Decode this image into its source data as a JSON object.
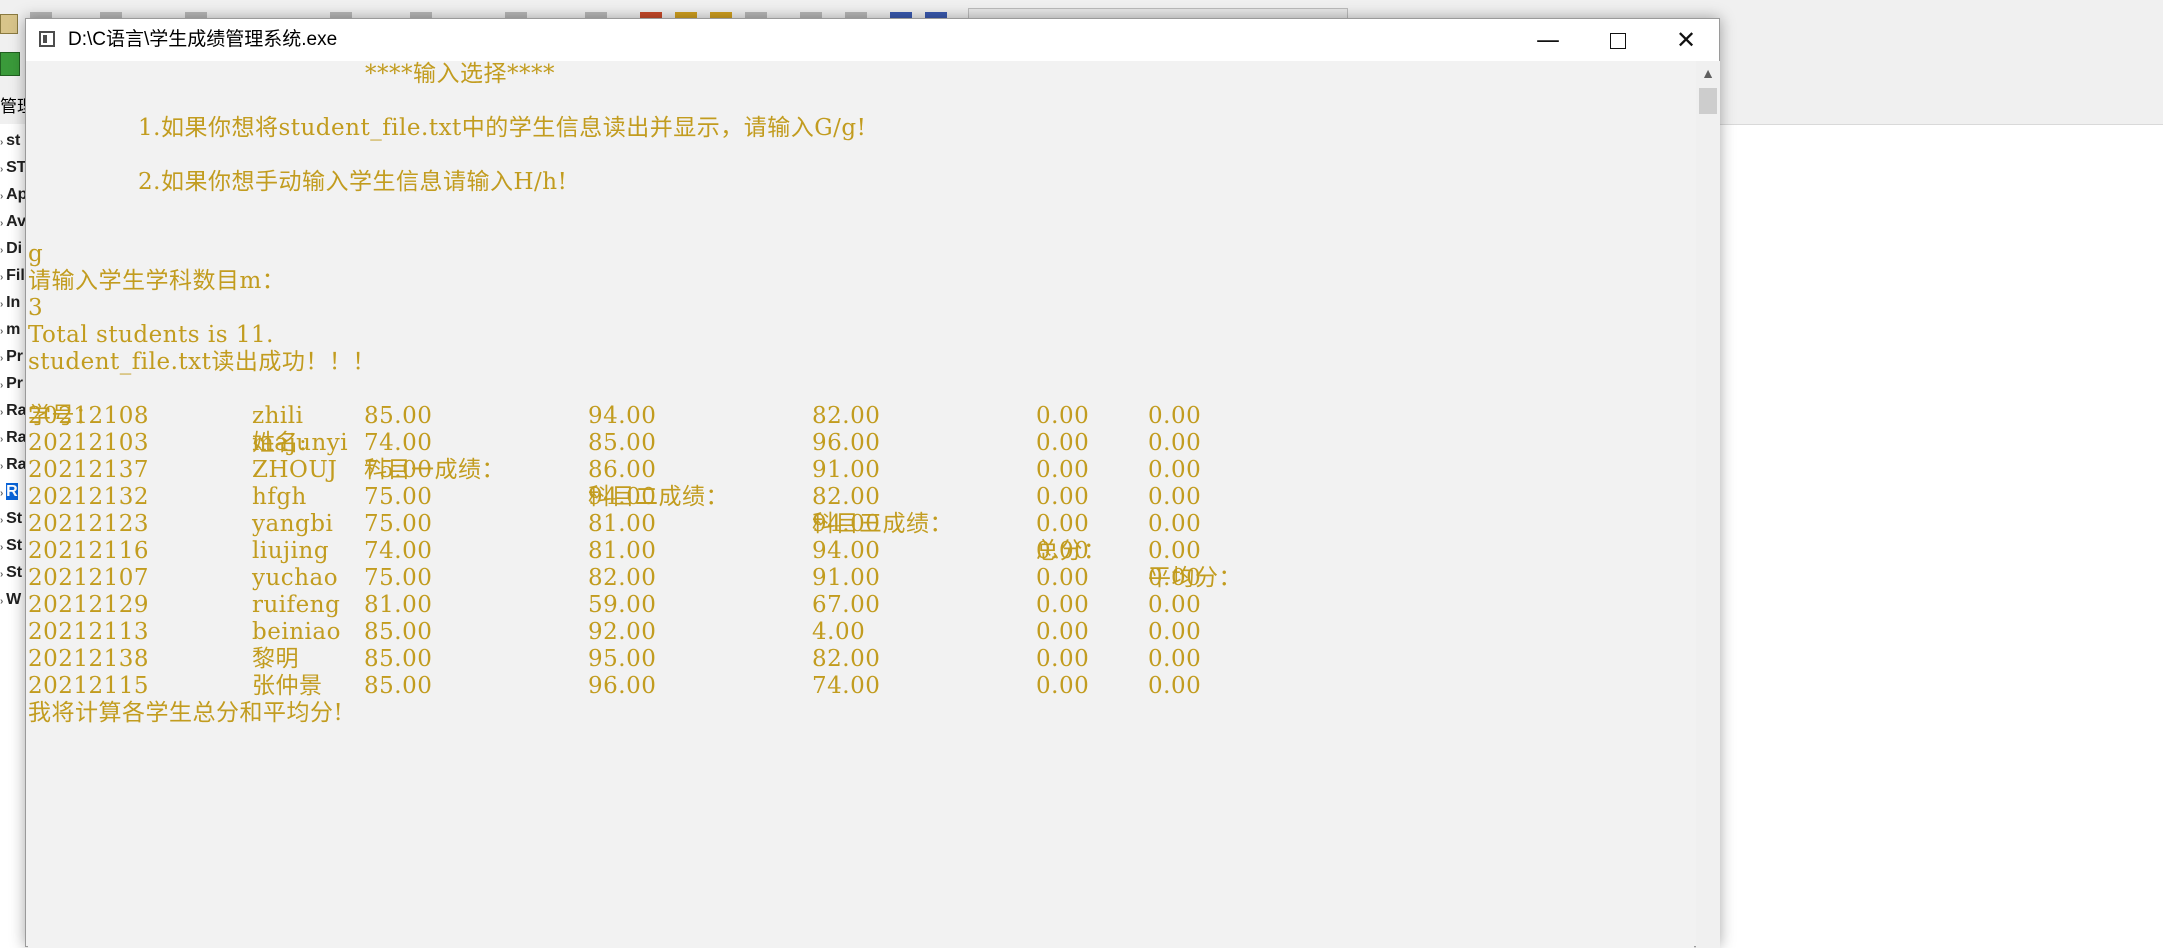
{
  "background": {
    "left_header": "管理",
    "items": [
      {
        "label": "st"
      },
      {
        "label": "ST"
      },
      {
        "label": "Ap"
      },
      {
        "label": "Av"
      },
      {
        "label": "Di"
      },
      {
        "label": "Fil"
      },
      {
        "label": "In"
      },
      {
        "label": "m"
      },
      {
        "label": "Pr"
      },
      {
        "label": "Pr"
      },
      {
        "label": "Ra"
      },
      {
        "label": "Ra"
      },
      {
        "label": "Ra"
      },
      {
        "label": "R",
        "selected": true
      },
      {
        "label": "St"
      },
      {
        "label": "St"
      },
      {
        "label": "St"
      },
      {
        "label": "W"
      }
    ]
  },
  "window": {
    "title": "D:\\C语言\\学生成绩管理系统.exe",
    "minimize_glyph": "—",
    "close_glyph": "✕"
  },
  "console": {
    "menu_title": "****输入选择****",
    "option1": "1.如果你想将student_file.txt中的学生信息读出并显示，请输入G/g!",
    "option2": "2.如果你想手动输入学生信息请输入H/h!",
    "input1": "g",
    "prompt_subjects": "请输入学生学科数目m：",
    "input2": "3",
    "total": "Total students is 11.",
    "read_success": "student_file.txt读出成功！！！",
    "headers": {
      "id": "学号：",
      "name": "姓名:",
      "s1": "科目一成绩：",
      "s2": "科目二成绩：",
      "s3": "科目三成绩：",
      "total": "总分：",
      "avg": "平均分："
    },
    "rows": [
      {
        "id": "20212108",
        "name": "zhili",
        "s1": "85.00",
        "s2": "94.00",
        "s3": "82.00",
        "total": "0.00",
        "avg": "0.00"
      },
      {
        "id": "20212103",
        "name": "majunyi",
        "s1": "74.00",
        "s2": "85.00",
        "s3": "96.00",
        "total": "0.00",
        "avg": "0.00"
      },
      {
        "id": "20212137",
        "name": "ZHOUJ",
        "s1": "75.00",
        "s2": "86.00",
        "s3": "91.00",
        "total": "0.00",
        "avg": "0.00"
      },
      {
        "id": "20212132",
        "name": "hfgh",
        "s1": "75.00",
        "s2": "94.00",
        "s3": "82.00",
        "total": "0.00",
        "avg": "0.00"
      },
      {
        "id": "20212123",
        "name": "yangbi",
        "s1": "75.00",
        "s2": "81.00",
        "s3": "94.00",
        "total": "0.00",
        "avg": "0.00"
      },
      {
        "id": "20212116",
        "name": "liujing",
        "s1": "74.00",
        "s2": "81.00",
        "s3": "94.00",
        "total": "0.00",
        "avg": "0.00"
      },
      {
        "id": "20212107",
        "name": "yuchao",
        "s1": "75.00",
        "s2": "82.00",
        "s3": "91.00",
        "total": "0.00",
        "avg": "0.00"
      },
      {
        "id": "20212129",
        "name": "ruifeng",
        "s1": "81.00",
        "s2": "59.00",
        "s3": "67.00",
        "total": "0.00",
        "avg": "0.00"
      },
      {
        "id": "20212113",
        "name": "beiniao",
        "s1": "85.00",
        "s2": "92.00",
        "s3": "4.00",
        "total": "0.00",
        "avg": "0.00"
      },
      {
        "id": "20212138",
        "name": "黎明",
        "s1": "85.00",
        "s2": "95.00",
        "s3": "82.00",
        "total": "0.00",
        "avg": "0.00"
      },
      {
        "id": "20212115",
        "name": "张仲景",
        "s1": "85.00",
        "s2": "96.00",
        "s3": "74.00",
        "total": "0.00",
        "avg": "0.00"
      }
    ],
    "footer": "我将计算各学生总分和平均分!"
  },
  "colors": {
    "console_text": "#c29c1f",
    "console_bg": "#f2f2f2"
  }
}
